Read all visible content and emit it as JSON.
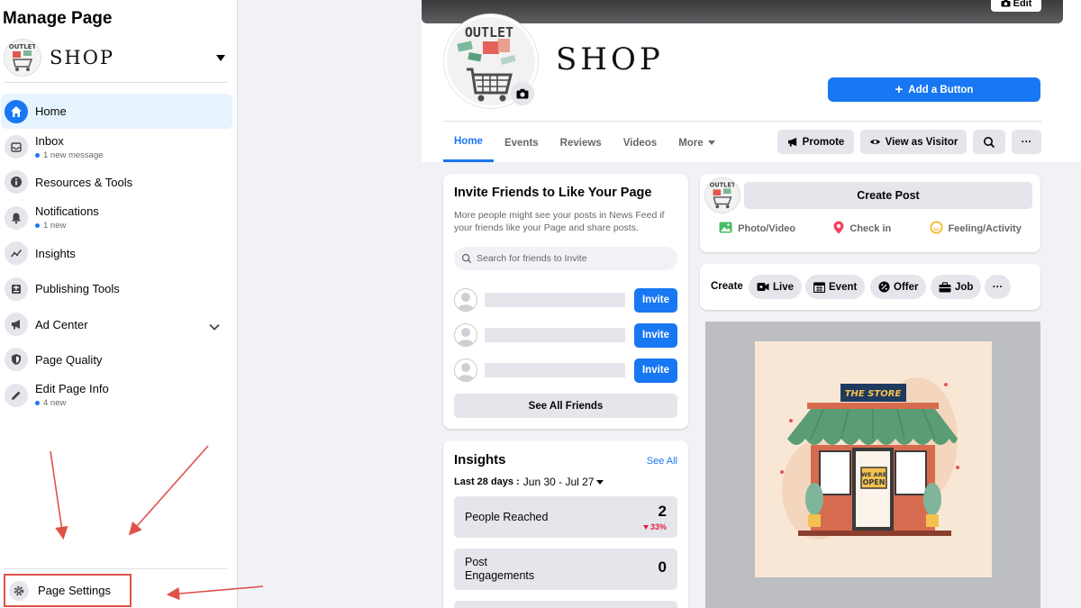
{
  "sidebar": {
    "title": "Manage Page",
    "page_name": "SHOP",
    "items": [
      {
        "label": "Home",
        "sub": ""
      },
      {
        "label": "Inbox",
        "sub": "1 new message"
      },
      {
        "label": "Resources & Tools",
        "sub": ""
      },
      {
        "label": "Notifications",
        "sub": "1 new"
      },
      {
        "label": "Insights",
        "sub": ""
      },
      {
        "label": "Publishing Tools",
        "sub": ""
      },
      {
        "label": "Ad Center",
        "sub": ""
      },
      {
        "label": "Page Quality",
        "sub": ""
      },
      {
        "label": "Edit Page Info",
        "sub": "4 new"
      }
    ],
    "settings_label": "Page Settings"
  },
  "header": {
    "edit_cover_label": "Edit",
    "page_name": "SHOP",
    "avatar_text": "OUTLET",
    "add_button_label": "Add a Button",
    "tabs": [
      "Home",
      "Events",
      "Reviews",
      "Videos",
      "More"
    ],
    "promote_label": "Promote",
    "view_as_label": "View as Visitor",
    "more_label": "···"
  },
  "invite": {
    "title": "Invite Friends to Like Your Page",
    "description": "More people might see your posts in News Feed if your friends like your Page and share posts.",
    "search_placeholder": "Search for friends to Invite",
    "invite_label": "Invite",
    "see_all_label": "See All Friends"
  },
  "insights": {
    "title": "Insights",
    "see_all_label": "See All",
    "period_label": "Last 28 days :",
    "period_range": "Jun 30 - Jul 27",
    "metrics": [
      {
        "label": "People Reached",
        "value": "2",
        "change": "33%"
      },
      {
        "label": "Post\nEngagements",
        "value": "0",
        "change": ""
      }
    ]
  },
  "composer": {
    "create_post_label": "Create Post",
    "photo_label": "Photo/Video",
    "checkin_label": "Check in",
    "feeling_label": "Feeling/Activity"
  },
  "create_bar": {
    "label": "Create",
    "live_label": "Live",
    "event_label": "Event",
    "offer_label": "Offer",
    "job_label": "Job",
    "more_label": "···"
  },
  "post": {
    "store_sign": "THE STORE",
    "open_sign_line1": "WE ARE",
    "open_sign_line2": "OPEN"
  },
  "colors": {
    "accent": "#1877f2",
    "annotation": "#e0514a"
  }
}
